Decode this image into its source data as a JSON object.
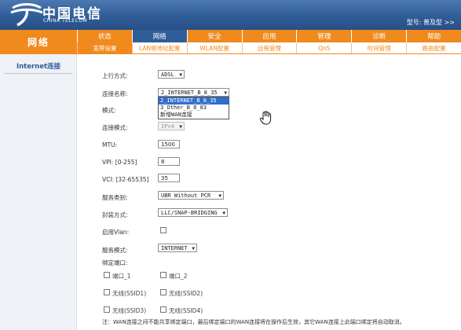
{
  "header": {
    "logo_cn": "中国电信",
    "logo_en": "CHINA TELECOM",
    "model": "型号: 普及型 >>"
  },
  "nav": {
    "section_title": "网络",
    "tabs": [
      {
        "label": "状态",
        "active": false
      },
      {
        "label": "网络",
        "active": true
      },
      {
        "label": "安全",
        "active": false
      },
      {
        "label": "应用",
        "active": false
      },
      {
        "label": "管理",
        "active": false
      },
      {
        "label": "诊断",
        "active": false
      },
      {
        "label": "帮助",
        "active": false
      }
    ],
    "subtabs": [
      {
        "label": "宽带设置",
        "active": true
      },
      {
        "label": "LAN侧地址配置",
        "active": false
      },
      {
        "label": "WLAN配置",
        "active": false
      },
      {
        "label": "远程管理",
        "active": false
      },
      {
        "label": "QoS",
        "active": false
      },
      {
        "label": "时间管理",
        "active": false
      },
      {
        "label": "路由配置",
        "active": false
      }
    ]
  },
  "sidebar": {
    "item": "Internet连接"
  },
  "form": {
    "uplink": {
      "label": "上行方式:",
      "value": "ADSL"
    },
    "conn_name": {
      "label": "连接名称:",
      "value": "2_INTERNET_B_8_35"
    },
    "mode": {
      "label": "模式:"
    },
    "proto": {
      "label": "连接模式:",
      "value": "IPv4"
    },
    "mtu": {
      "label": "MTU:",
      "value": "1500"
    },
    "vpi": {
      "label": "VPI: [0-255]",
      "value": "8"
    },
    "vci": {
      "label": "VCI: [32-65535]",
      "value": "35"
    },
    "service_type": {
      "label": "服务类别:",
      "value": "UBR Without PCR"
    },
    "encap": {
      "label": "封装方式:",
      "value": "LLC/SNAP-BRIDGING"
    },
    "vlan": {
      "label": "启用Vlan:"
    },
    "service_mode": {
      "label": "服务模式:",
      "value": "INTERNET"
    },
    "bind_port": {
      "label": "绑定端口:"
    },
    "ports": [
      {
        "label": "端口_1"
      },
      {
        "label": "端口_2"
      },
      {
        "label": "无线(SSID1)"
      },
      {
        "label": "无线(SSID2)"
      },
      {
        "label": "无线(SSID3)"
      },
      {
        "label": "无线(SSID4)"
      }
    ],
    "dropdown_options": [
      "2_INTERNET_B_8_35",
      "3_Other_B_8_83",
      "新增WAN连接"
    ],
    "note": "注：WAN连接之间不能共享绑定端口，最后绑定端口的WAN连接将在操作后生效，其它WAN连接上此端口绑定将自动取消。"
  }
}
